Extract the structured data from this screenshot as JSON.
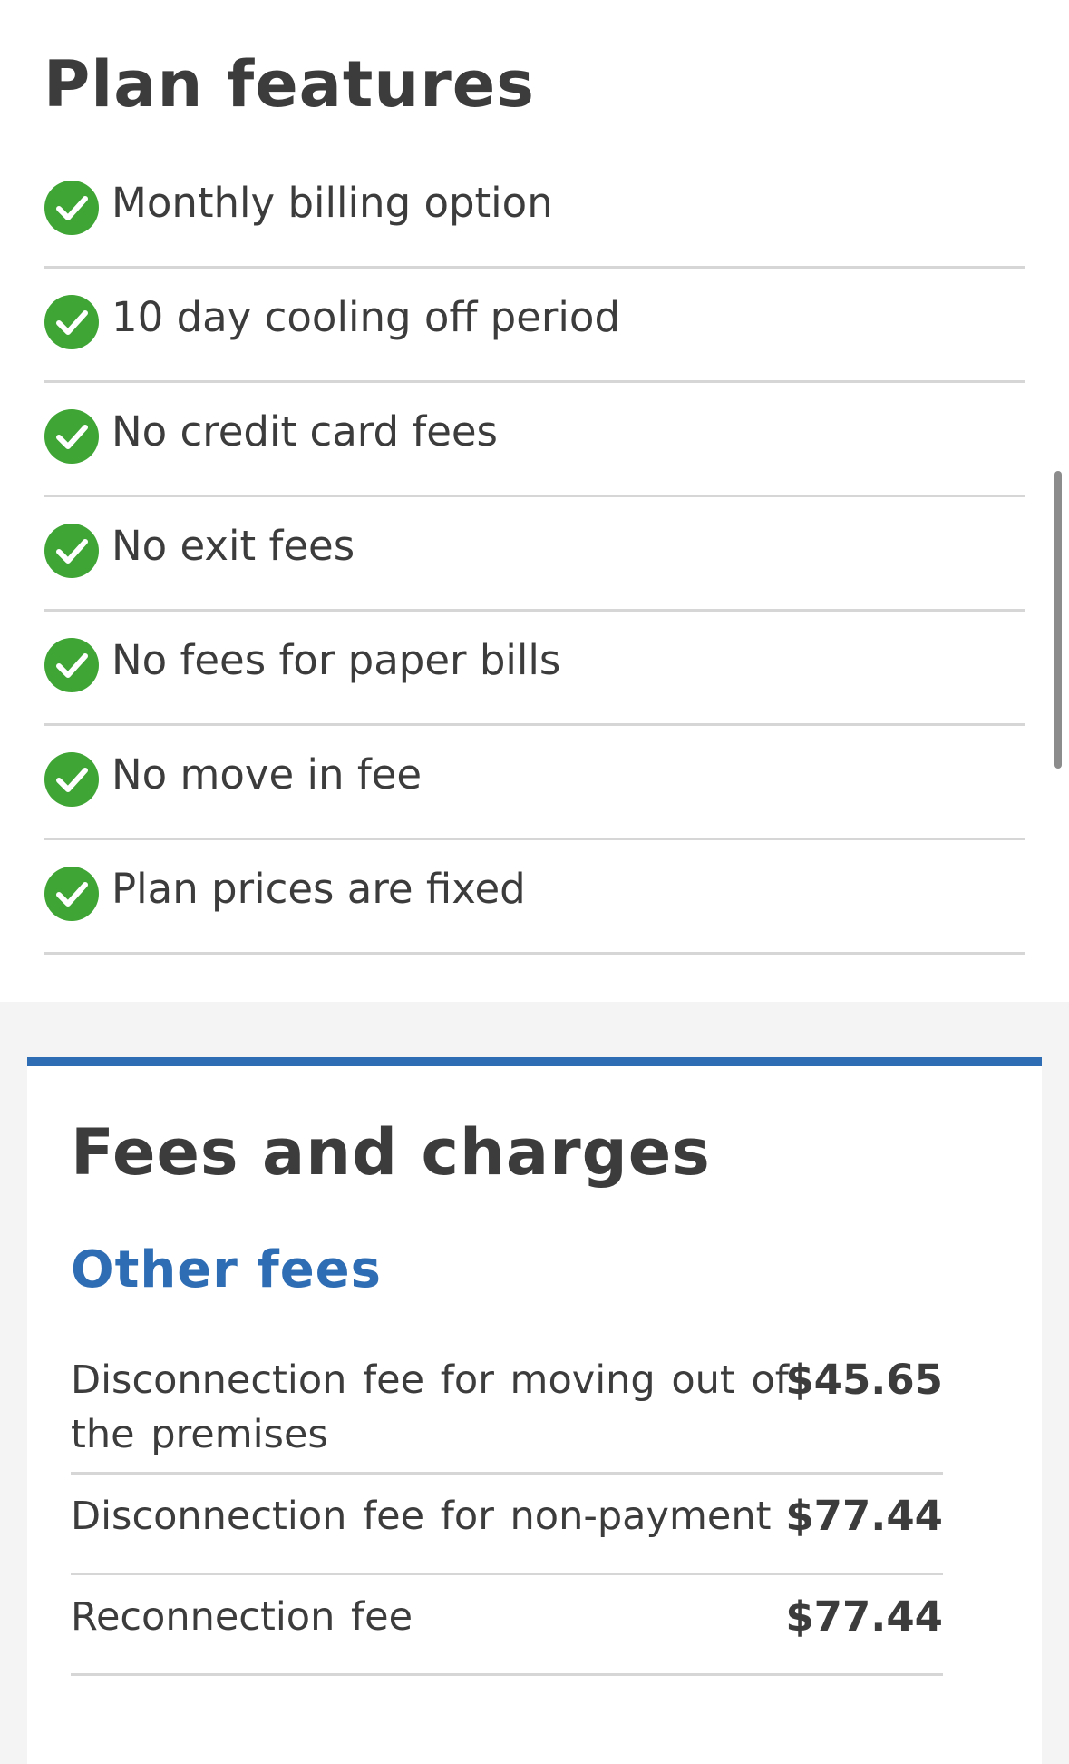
{
  "colors": {
    "check_green": "#3fa535",
    "accent_blue": "#2e6db4",
    "text": "#3c3c3c",
    "divider": "#d6d6d6",
    "section_bg": "#f4f4f4"
  },
  "plan_features": {
    "title": "Plan features",
    "icon": "check-circle-icon",
    "items": [
      {
        "label": "Monthly billing option"
      },
      {
        "label": "10 day cooling off period"
      },
      {
        "label": "No credit card fees"
      },
      {
        "label": "No exit fees"
      },
      {
        "label": "No fees for paper bills"
      },
      {
        "label": "No move in fee"
      },
      {
        "label": "Plan prices are fixed"
      }
    ]
  },
  "fees": {
    "title": "Fees and charges",
    "other_fees": {
      "title": "Other fees",
      "rows": [
        {
          "label": "Disconnection fee for moving out of the premises",
          "amount": "$45.65"
        },
        {
          "label": "Disconnection fee for non-payment",
          "amount": "$77.44"
        },
        {
          "label": "Reconnection fee",
          "amount": "$77.44"
        }
      ]
    }
  }
}
